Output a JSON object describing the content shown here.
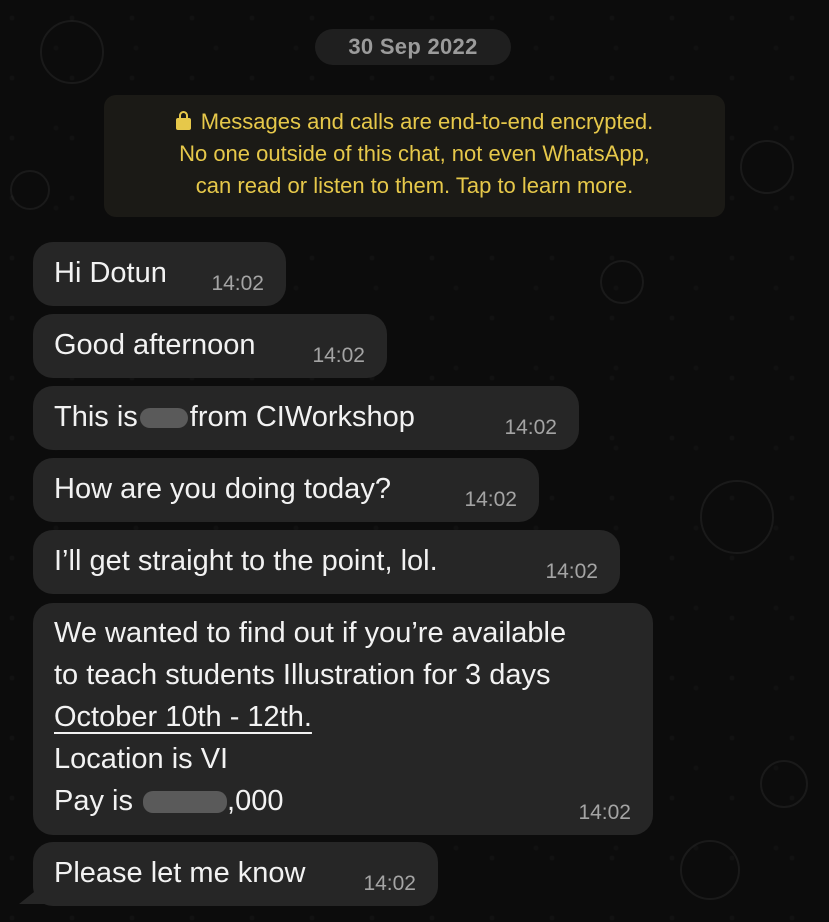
{
  "date_label": "30 Sep 2022",
  "encryption_notice": {
    "line1": "Messages and calls are end-to-end encrypted.",
    "line2": "No one outside of this chat, not even WhatsApp,",
    "line3": "can read or listen to them. Tap to learn more.",
    "icon": "lock-icon"
  },
  "messages": [
    {
      "text": "Hi Dotun",
      "time": "14:02"
    },
    {
      "text": "Good afternoon",
      "time": "14:02"
    },
    {
      "text_before": "This is",
      "text_after": "from CIWorkshop",
      "time": "14:02"
    },
    {
      "text": "How are you doing today?",
      "time": "14:02"
    },
    {
      "text": "I’ll get straight to the point, lol.",
      "time": "14:02"
    },
    {
      "line1": "We wanted to find out if you’re available",
      "line2": "to teach students Illustration for 3 days",
      "line3": "October 10th - 12th.",
      "line4": "Location is VI",
      "line5_prefix": "Pay is",
      "line5_suffix": ",000",
      "time": "14:02"
    },
    {
      "text": "Please let me know",
      "time": "14:02"
    }
  ],
  "colors": {
    "background": "#0b0b0b",
    "bubble": "#262626",
    "notice_text": "#e6c84a",
    "timestamp": "#a4a4a4"
  }
}
